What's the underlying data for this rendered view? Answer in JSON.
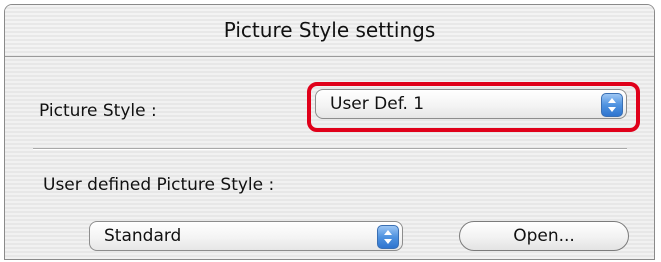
{
  "dialog": {
    "title": "Picture Style settings"
  },
  "picture_style": {
    "label": "Picture Style :",
    "selected": "User Def. 1"
  },
  "user_defined": {
    "label": "User defined Picture Style :",
    "selected": "Standard",
    "open_button": "Open..."
  },
  "colors": {
    "highlight": "#e0001a",
    "stepper_blue": "#4f93e0"
  },
  "icons": {
    "stepper": "up-down-arrows-icon"
  }
}
